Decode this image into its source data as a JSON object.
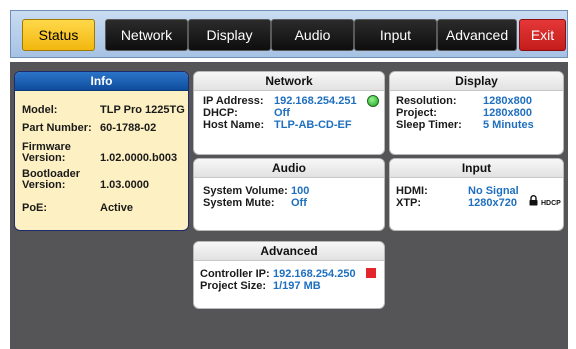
{
  "tabs": [
    {
      "label": "Status",
      "active": true
    },
    {
      "label": "Network"
    },
    {
      "label": "Display"
    },
    {
      "label": "Audio"
    },
    {
      "label": "Input"
    },
    {
      "label": "Advanced"
    },
    {
      "label": "Exit",
      "danger": true
    }
  ],
  "info": {
    "title": "Info",
    "model_label": "Model:",
    "model_value": "TLP Pro 1225TG",
    "part_label": "Part Number:",
    "part_value": "60-1788-02",
    "fw_label_1": "Firmware",
    "fw_label_2": "Version:",
    "fw_value": "1.02.0000.b003",
    "bl_label_1": "Bootloader",
    "bl_label_2": "Version:",
    "bl_value": "1.03.0000",
    "poe_label": "PoE:",
    "poe_value": "Active"
  },
  "network": {
    "title": "Network",
    "ip_label": "IP Address:",
    "ip_value": "192.168.254.251",
    "dhcp_label": "DHCP:",
    "dhcp_value": "Off",
    "host_label": "Host Name:",
    "host_value": "TLP-AB-CD-EF",
    "status_color": "#1ea21e"
  },
  "display": {
    "title": "Display",
    "res_label": "Resolution:",
    "res_value": "1280x800",
    "proj_label": "Project:",
    "proj_value": "1280x800",
    "sleep_label": "Sleep Timer:",
    "sleep_value": "5 Minutes"
  },
  "audio": {
    "title": "Audio",
    "vol_label": "System Volume:",
    "vol_value": "100",
    "mute_label": "System Mute:",
    "mute_value": "Off"
  },
  "input": {
    "title": "Input",
    "hdmi_label": "HDMI:",
    "hdmi_value": "No Signal",
    "xtp_label": "XTP:",
    "xtp_value": "1280x720",
    "hdcp_text": "HDCP"
  },
  "advanced": {
    "title": "Advanced",
    "ctrl_label": "Controller IP:",
    "ctrl_value": "192.168.254.250",
    "proj_label": "Project Size:",
    "proj_value": "1/197 MB",
    "status_color": "#e3262b"
  },
  "colors": {
    "accent_yellow": "#f2b70f",
    "value_blue": "#1f6fbf",
    "exit_red": "#c41c1c",
    "panel_bg": "#555557"
  }
}
